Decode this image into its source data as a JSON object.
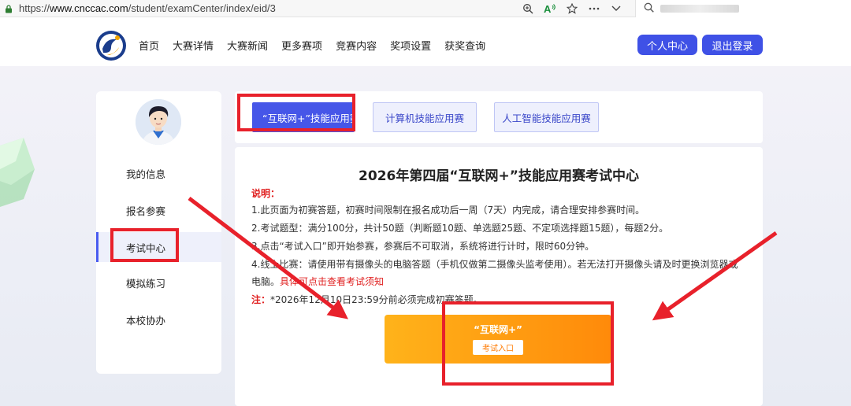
{
  "browser": {
    "url_prefix": "https://",
    "url_domain": "www.cnccac.com",
    "url_path": "/student/examCenter/index/eid/3",
    "icons": [
      "zoom-icon",
      "read-aloud-icon",
      "favorite-star-icon",
      "more-icon",
      "chevron-down-icon"
    ],
    "search_icon": "search-icon"
  },
  "header": {
    "nav": [
      "首页",
      "大赛详情",
      "大赛新闻",
      "更多赛项",
      "竞赛内容",
      "奖项设置",
      "获奖查询"
    ],
    "personal_center": "个人中心",
    "logout": "退出登录"
  },
  "sidebar": {
    "items": [
      "我的信息",
      "报名参赛",
      "考试中心",
      "模拟练习",
      "本校协办"
    ],
    "active_index": 2
  },
  "tabs": {
    "items": [
      "“互联网+”技能应用赛",
      "计算机技能应用赛",
      "人工智能技能应用赛"
    ],
    "active_index": 0
  },
  "main": {
    "title": "2026年第四届“互联网+”技能应用赛考试中心",
    "note_heading": "说明：",
    "lines": [
      "1.此页面为初赛答题，初赛时间限制在报名成功后一周（7天）内完成，请合理安排参赛时间。",
      "2.考试题型：满分100分，共计50题（判断题10题、单选题25题、不定项选择题15题），每题2分。",
      "3.点击“考试入口”即开始参赛，参赛后不可取消，系统将进行计时，限时60分钟。",
      "4.线上比赛：请使用带有摄像头的电脑答题（手机仅做第二摄像头监考使用）。若无法打开摄像头请及时更换浏览器或",
      "电脑。"
    ],
    "line5_red": "具体可点击查看考试须知",
    "note_label": "注：",
    "note_text": "*2026年12月10日23:59分前必须完成初赛答题。",
    "entry_title": "“互联网+”",
    "entry_button": "考试入口"
  },
  "colors": {
    "accent": "#3f51e6",
    "annotation_red": "#e8212b",
    "entry_orange": "#ff9a10"
  }
}
